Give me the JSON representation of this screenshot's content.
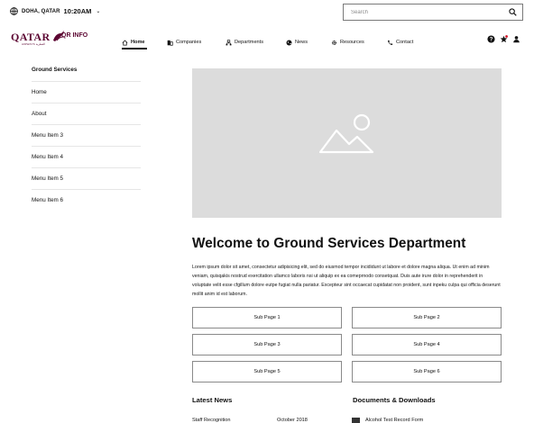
{
  "top": {
    "location": "DOHA, QATAR",
    "time": "10:20AM",
    "search_placeholder": "Search"
  },
  "brand": {
    "logo_text": "QATAR",
    "logo_subtext": "AIRWAYS القطرية",
    "app_name": "QR INFO",
    "color": "#5c0632"
  },
  "nav": [
    {
      "label": "Home",
      "icon": "home-icon",
      "active": true
    },
    {
      "label": "Companies",
      "icon": "building-icon"
    },
    {
      "label": "Departments",
      "icon": "org-icon"
    },
    {
      "label": "News",
      "icon": "globe-icon"
    },
    {
      "label": "Resources",
      "icon": "gear-icon"
    },
    {
      "label": "Contact",
      "icon": "phone-icon"
    }
  ],
  "util_icons": [
    "help-icon",
    "favorites-star-icon",
    "user-icon"
  ],
  "sidebar": {
    "title": "Ground Services",
    "items": [
      "Home",
      "About",
      "Menu Item 3",
      "Menu Item 4",
      "Menu Item 5",
      "Menu Item 6"
    ]
  },
  "main": {
    "title": "Welcome to Ground Services Department",
    "paragraph": "Lorem ipsum dolor sit amet, consectetur adipisicing elit, sed do eiusmod tempor incididunt ut labore et dolore magna aliqua. Ut enim ad minim veniam, quisqakis nostrud exercitation ullamco laboris nsi ut aliquip ex ea comeprnodo consetquat. Duis aute irure dolor in reprehenderit in voluptate velit esse cfgillum dolore eutpe fugiat nulla pariatur. Excepteur sint occaecat cupidatat non proident, sunt inpeku culpa qui officia deserunt mollit anim id est laborum.",
    "subpages": [
      "Sub Page 1",
      "Sub Page 2",
      "Sub Page 3",
      "Sub Page 4",
      "Sub Page 5",
      "Sub Page 6"
    ]
  },
  "news": {
    "heading": "Latest News",
    "item_title": "Staff Recognition",
    "item_date": "October 2018"
  },
  "docs": {
    "heading": "Documents & Downloads",
    "item": "Alcohol Test Record Form"
  }
}
